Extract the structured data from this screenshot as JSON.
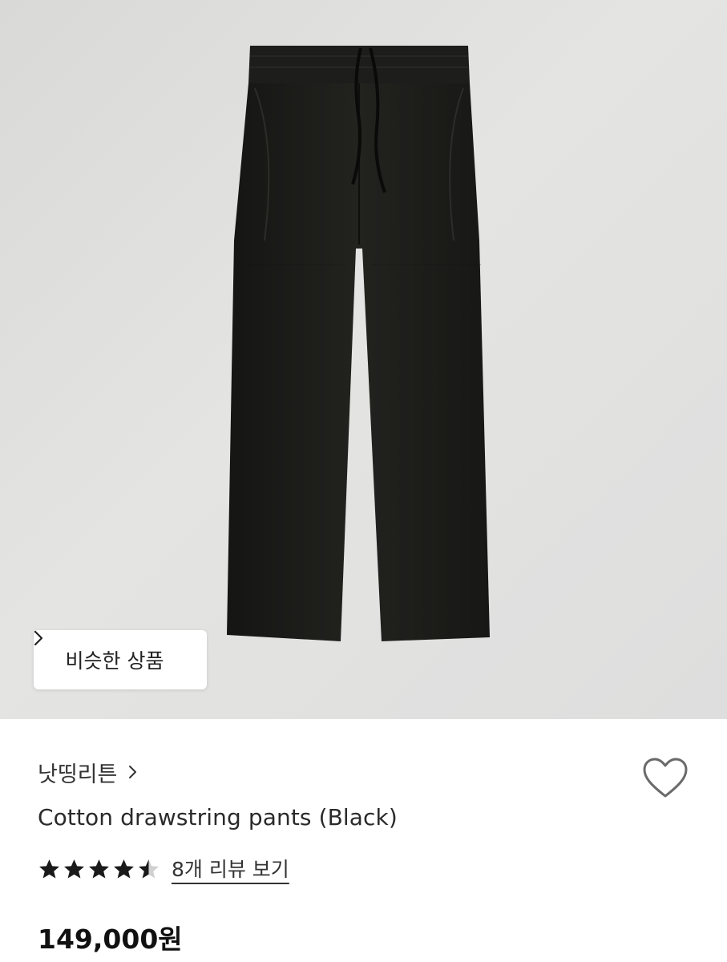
{
  "similar_button": {
    "label": "비슷한 상품",
    "icon": "chevron-right-icon"
  },
  "product": {
    "brand": "낫띵리튼",
    "title": "Cotton drawstring pants (Black)",
    "rating": 4.5,
    "rating_max": 5,
    "review_link": "8개 리뷰 보기",
    "price": "149,000원"
  },
  "icons": {
    "wishlist": "heart-outline-icon",
    "brand_chevron": "chevron-right-icon",
    "star": "star-icon"
  },
  "colors": {
    "star": "#1a1a1a",
    "price": "#111111",
    "hero_background": "#dededc",
    "pants": "#1c1c1a"
  }
}
